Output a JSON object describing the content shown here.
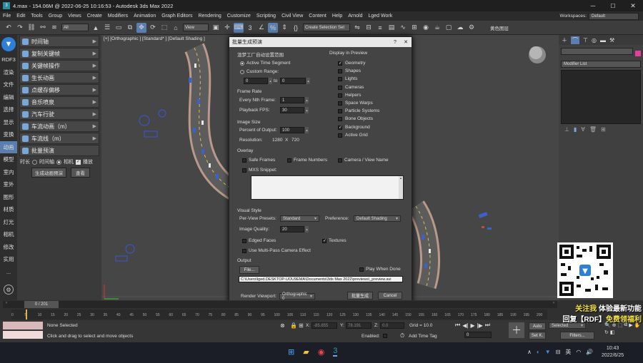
{
  "title": "4.max - 154.06M @ 2022-06-25 10:16:53 - Autodesk 3ds Max 2022",
  "menu": [
    "File",
    "Edit",
    "Tools",
    "Group",
    "Views",
    "Create",
    "Modifiers",
    "Animation",
    "Graph Editors",
    "Rendering",
    "Customize",
    "Scripting",
    "Civil View",
    "Content",
    "Help",
    "Arnold",
    "Lged Work"
  ],
  "workspaces_label": "Workspaces:",
  "workspaces_value": "Default",
  "toolbar": {
    "filter": "All",
    "view": "View",
    "selection_set": "Create Selection Set",
    "right_label": "黄色图层"
  },
  "left_tabs": [
    "RDF3",
    "渲染",
    "文件",
    "编辑",
    "选择",
    "显示",
    "变换",
    "动画",
    "模型",
    "室内",
    "室外",
    "图形",
    "材质",
    "灯光",
    "相机",
    "修改",
    "实用",
    "..."
  ],
  "side": {
    "buttons": [
      "时间轴",
      "复制关键帧",
      "关键帧操作",
      "生长动画",
      "点缓存偏移",
      "音乐喷泉",
      "汽车行驶",
      "车流动画（m）",
      "车流线（m）",
      "批量预演"
    ],
    "radio_label": "时长",
    "opt1": "时间轴",
    "opt2": "相机",
    "opt3": "播放",
    "gen_btn": "生成动画预演",
    "view_btn": "查看"
  },
  "viewport_label": "[+] [Orthographic ] [Standard* ] [Default Shading ]",
  "dialog": {
    "title": "批量生成预演",
    "help": "?",
    "close": "✕",
    "range_title": "渲梦工厂自动设置范围",
    "active_time": "Active Time Segment",
    "custom_range": "Custom Range:",
    "range_from": "0",
    "to": "to",
    "range_to": "0",
    "frame_rate": "Frame Rate",
    "every_nth": "Every Nth Frame:",
    "every_nth_val": "1",
    "playback_fps": "Playback FPS:",
    "playback_fps_val": "30",
    "image_size": "Image Size",
    "percent_output": "Percent of Output:",
    "percent_val": "100",
    "resolution": "Resolution:",
    "res_w": "1280",
    "res_x": "X",
    "res_h": "720",
    "display_in_preview": "Display in Preview",
    "display_items": [
      "Geometry",
      "Shapes",
      "Lights",
      "Cameras",
      "Helpers",
      "Space Warps",
      "Particle Systems",
      "Bone Objects",
      "Background",
      "Active Grid"
    ],
    "overlay": "Overlay",
    "safe_frames": "Safe Frames",
    "frame_numbers": "Frame Numbers",
    "camera_view_name": "Camera / View Name",
    "mxs_snippet": "MXS Snippet:",
    "visual_style": "Visual Style",
    "per_view_presets": "Per-View Presets:",
    "preset_val": "Standard",
    "preference": "Preference:",
    "preference_val": "Default Shading",
    "image_quality": "Image Quality:",
    "image_quality_val": "20",
    "edged_faces": "Edged Faces",
    "textures": "Textures",
    "multi_pass": "Use Multi-Pass Camera Effect",
    "output": "Output",
    "file_btn": "File...",
    "play_when_done": "Play When Done",
    "path": "C:\\Users\\lged.DESKTOP-UOU9EMA\\Documents\\3ds Max 2022\\previews\\_preview.avi",
    "render_viewport": "Render Viewport:",
    "render_viewport_val": "Orthographic 0",
    "generate_btn": "批量生成",
    "cancel_btn": "Cancel"
  },
  "cmd": {
    "modifier_list": "Modifier List"
  },
  "timeline": {
    "frame": "0 / 201",
    "ticks": [
      "0",
      "5",
      "10",
      "15",
      "20",
      "25",
      "30",
      "35",
      "40",
      "45",
      "50",
      "55",
      "60",
      "65",
      "70",
      "75",
      "80",
      "85",
      "90",
      "95",
      "100",
      "105",
      "110",
      "115",
      "120",
      "125",
      "130",
      "135",
      "140",
      "145",
      "150",
      "155",
      "160",
      "165",
      "170",
      "175",
      "180",
      "185",
      "190",
      "195",
      "200"
    ]
  },
  "status": {
    "none_selected": "None Selected",
    "hint": "Click and drag to select and move objects",
    "x_label": "X:",
    "x_val": "-85.855",
    "y_label": "Y:",
    "y_val": "78.191",
    "z_label": "Z:",
    "z_val": "0.0",
    "grid": "Grid = 10.0",
    "enabled": "Enabled:",
    "add_time_tag": "Add Time Tag",
    "auto": "Auto",
    "selected": "Selected",
    "setk": "Set K.",
    "filters": "Filters...",
    "frame_val": "0"
  },
  "promo": {
    "line1a": "关注我",
    "line1b": "体验最新功能",
    "line2a": "回复【RDF】",
    "line2b": "免费领福利"
  },
  "taskbar": {
    "time": "10:43",
    "date": "2022/6/25",
    "lang": "英"
  }
}
